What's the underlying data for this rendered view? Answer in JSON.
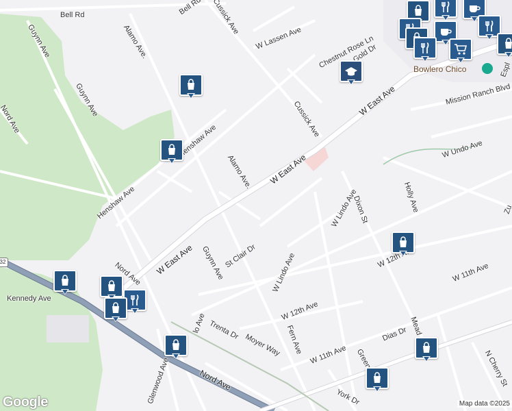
{
  "map": {
    "colors": {
      "background": "#f2f1f4",
      "park": "#cfe8c7",
      "road": "#ffffff",
      "road_casing": "#d6d6dc",
      "highway": "#8f9fb5",
      "highway_border": "#6b7b92",
      "marker": "#2a5b8f",
      "commercial": "#f7d6d6",
      "poi_text": "#6b4a2a"
    },
    "street_labels": [
      {
        "id": "bell-rd",
        "text": "Bell Rd"
      },
      {
        "id": "bell-rd-2",
        "text": "Bell Rd"
      },
      {
        "id": "cussick-ave-top",
        "text": "Cussick Ave"
      },
      {
        "id": "w-lassen-ave",
        "text": "W Lassen Ave"
      },
      {
        "id": "chestnut-rose-ln",
        "text": "Chestnut Rose Ln"
      },
      {
        "id": "gold-dr",
        "text": "Gold Dr"
      },
      {
        "id": "guynn-ave-1",
        "text": "Guynn Ave"
      },
      {
        "id": "alamo-ave-top",
        "text": "Alamo Ave."
      },
      {
        "id": "guynn-ave-2",
        "text": "Guynn Ave"
      },
      {
        "id": "nord-ave-top",
        "text": "Nord Ave"
      },
      {
        "id": "henshaw-ave-1",
        "text": "Henshaw Ave"
      },
      {
        "id": "henshaw-ave-2",
        "text": "Henshaw Ave"
      },
      {
        "id": "cussick-ave-mid",
        "text": "Cussick Ave"
      },
      {
        "id": "w-east-ave-1",
        "text": "W East Ave"
      },
      {
        "id": "w-east-ave-2",
        "text": "W East Ave"
      },
      {
        "id": "w-east-ave-3",
        "text": "W East Ave"
      },
      {
        "id": "mission-ranch-blvd",
        "text": "Mission Ranch Blvd"
      },
      {
        "id": "alamo-ave-mid",
        "text": "Alamo Ave."
      },
      {
        "id": "w-undo-ave",
        "text": "W Undo Ave"
      },
      {
        "id": "holly-ave",
        "text": "Holly Ave"
      },
      {
        "id": "w-lindo-ave-1",
        "text": "W Lindo Ave"
      },
      {
        "id": "dixon-st",
        "text": "Dixon St"
      },
      {
        "id": "st-clair-dr",
        "text": "St Clair Dr"
      },
      {
        "id": "guynn-ave-3",
        "text": "Guynn Ave"
      },
      {
        "id": "w-lindo-ave-2",
        "text": "W Lindo Ave"
      },
      {
        "id": "nord-ave-mid",
        "text": "Nord Ave"
      },
      {
        "id": "w-12th-ave-1",
        "text": "W 12th Ave"
      },
      {
        "id": "w-11th-ave-1",
        "text": "W 11th Ave"
      },
      {
        "id": "kennedy-ave",
        "text": "Kennedy Ave"
      },
      {
        "id": "w-12th-ave-2",
        "text": "W 12th Ave"
      },
      {
        "id": "trenta-dr",
        "text": "Trenta Dr"
      },
      {
        "id": "moyer-way",
        "text": "Moyer Way"
      },
      {
        "id": "fern-ave",
        "text": "Fern Ave"
      },
      {
        "id": "w-11th-ave-2",
        "text": "W 11th Ave"
      },
      {
        "id": "dias-dr",
        "text": "Dias Dr"
      },
      {
        "id": "mead",
        "text": "Mead"
      },
      {
        "id": "n-cherry-st",
        "text": "N Cherry St"
      },
      {
        "id": "glenwood-ave",
        "text": "Glenwood Ave"
      },
      {
        "id": "nord-ave-bottom",
        "text": "Nord Ave"
      },
      {
        "id": "green",
        "text": "Green"
      },
      {
        "id": "york-dr",
        "text": "York Dr"
      },
      {
        "id": "lo-ave",
        "text": "lo Ave"
      },
      {
        "id": "espl",
        "text": "Espl"
      },
      {
        "id": "zu",
        "text": "Zu"
      }
    ],
    "places": [
      {
        "id": "bowlero-chico",
        "text": "Bowlero Chico"
      }
    ],
    "route_shield": "32",
    "markers": [
      {
        "id": "bag-1",
        "icon": "shopping-bag-icon"
      },
      {
        "id": "bag-2",
        "icon": "shopping-bag-icon"
      },
      {
        "id": "bag-3",
        "icon": "shopping-bag-icon"
      },
      {
        "id": "bag-4",
        "icon": "shopping-bag-icon"
      },
      {
        "id": "bag-5",
        "icon": "shopping-bag-icon"
      },
      {
        "id": "bag-6",
        "icon": "shopping-bag-icon"
      },
      {
        "id": "bag-7",
        "icon": "shopping-bag-icon"
      },
      {
        "id": "bag-8",
        "icon": "shopping-bag-icon"
      },
      {
        "id": "bag-9",
        "icon": "shopping-bag-icon"
      },
      {
        "id": "bag-10",
        "icon": "shopping-bag-icon"
      },
      {
        "id": "restaurant-1",
        "icon": "restaurant-icon"
      },
      {
        "id": "school-1",
        "icon": "school-icon"
      },
      {
        "id": "cluster-bag-1",
        "icon": "shopping-bag-icon"
      },
      {
        "id": "cluster-bag-2",
        "icon": "shopping-bag-icon"
      },
      {
        "id": "cluster-restaurant-1",
        "icon": "restaurant-icon"
      },
      {
        "id": "cluster-restaurant-2",
        "icon": "restaurant-icon"
      },
      {
        "id": "cluster-restaurant-3",
        "icon": "restaurant-icon"
      },
      {
        "id": "cluster-coffee-1",
        "icon": "coffee-icon"
      },
      {
        "id": "cluster-coffee-2",
        "icon": "coffee-icon"
      },
      {
        "id": "cluster-cart-1",
        "icon": "shopping-cart-icon"
      }
    ],
    "logo": "Google",
    "attribution": "Map data ©2025"
  }
}
